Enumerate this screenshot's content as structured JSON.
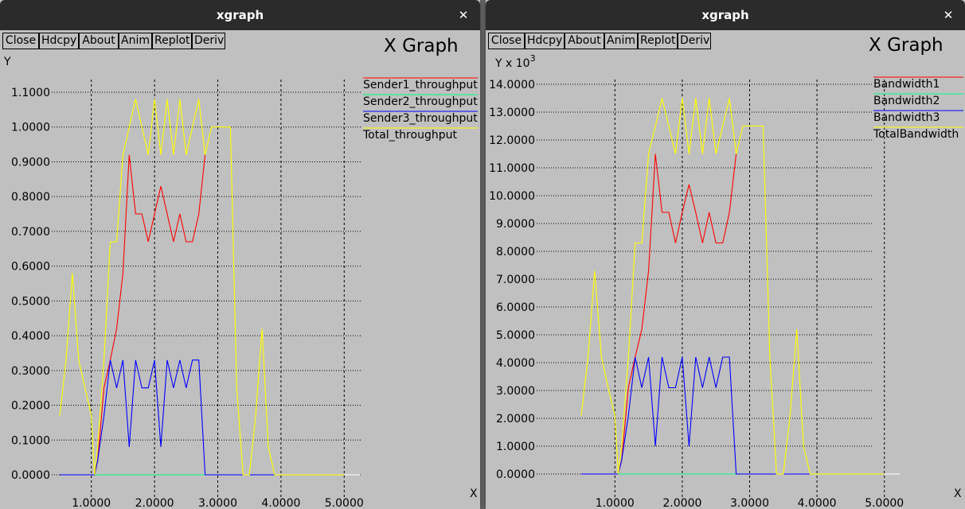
{
  "windows": [
    {
      "id": "left",
      "window_title": "xgraph",
      "buttons": [
        "Close",
        "Hdcpy",
        "About",
        "Anim",
        "Replot",
        "Deriv"
      ],
      "graph_title": "X Graph",
      "ylabel": "Y",
      "xlabel": "X",
      "yticks": [
        "1.1000",
        "1.0000",
        "0.9000",
        "0.8000",
        "0.7000",
        "0.6000",
        "0.5000",
        "0.4000",
        "0.3000",
        "0.2000",
        "0.1000",
        "0.0000"
      ],
      "xticks": [
        "1.0000",
        "2.0000",
        "3.0000",
        "4.0000",
        "5.0000"
      ],
      "legend": [
        "Sender1_throughput",
        "Sender2_throughput",
        "Sender3_throughput",
        "Total_throughput"
      ]
    },
    {
      "id": "right",
      "window_title": "xgraph",
      "buttons": [
        "Close",
        "Hdcpy",
        "About",
        "Anim",
        "Replot",
        "Deriv"
      ],
      "graph_title": "X Graph",
      "ylabel": "Y x 10",
      "ylabel_exp": "3",
      "xlabel": "X",
      "yticks": [
        "14.0000",
        "13.0000",
        "12.0000",
        "11.0000",
        "10.0000",
        "9.0000",
        "8.0000",
        "7.0000",
        "6.0000",
        "5.0000",
        "4.0000",
        "3.0000",
        "2.0000",
        "1.0000",
        "0.0000"
      ],
      "xticks": [
        "1.0000",
        "2.0000",
        "3.0000",
        "4.0000",
        "5.0000"
      ],
      "legend": [
        "Bandwidth1",
        "Bandwidth2",
        "Bandwidth3",
        "TotalBandwidth"
      ]
    }
  ],
  "chart_data": [
    {
      "type": "line",
      "title": "X Graph",
      "xlabel": "X",
      "ylabel": "Y",
      "xlim": [
        0.5,
        5.0
      ],
      "ylim": [
        0,
        1.1
      ],
      "grid": true,
      "legend_position": "right",
      "series": [
        {
          "name": "Sender1_throughput",
          "color": "#ff0000",
          "x": [
            1.0,
            1.05,
            1.1,
            1.2,
            1.3,
            1.4,
            1.5,
            1.6,
            1.7,
            1.8,
            1.9,
            2.0,
            2.1,
            2.2,
            2.3,
            2.4,
            2.5,
            2.6,
            2.7,
            2.8
          ],
          "y": [
            0,
            0,
            0.04,
            0.25,
            0.33,
            0.42,
            0.58,
            0.92,
            0.75,
            0.75,
            0.67,
            0.75,
            0.83,
            0.75,
            0.67,
            0.75,
            0.67,
            0.67,
            0.75,
            0.92
          ]
        },
        {
          "name": "Sender2_throughput",
          "color": "#00ff7f",
          "x": [
            0.5,
            5.0
          ],
          "y": [
            0,
            0
          ]
        },
        {
          "name": "Sender3_throughput",
          "color": "#0000ff",
          "x": [
            0.5,
            1.05,
            1.1,
            1.2,
            1.3,
            1.4,
            1.5,
            1.6,
            1.7,
            1.8,
            1.9,
            2.0,
            2.1,
            2.2,
            2.3,
            2.4,
            2.5,
            2.6,
            2.7,
            2.8,
            3.0,
            4.0,
            5.0
          ],
          "y": [
            0,
            0,
            0.04,
            0.17,
            0.33,
            0.25,
            0.33,
            0.08,
            0.33,
            0.25,
            0.25,
            0.33,
            0.08,
            0.33,
            0.25,
            0.33,
            0.25,
            0.33,
            0.33,
            0,
            0,
            0,
            0
          ]
        },
        {
          "name": "Total_throughput",
          "color": "#ffff00",
          "x": [
            0.5,
            0.6,
            0.7,
            0.8,
            0.9,
            1.0,
            1.05,
            1.1,
            1.2,
            1.3,
            1.4,
            1.5,
            1.6,
            1.7,
            1.8,
            1.9,
            2.0,
            2.1,
            2.2,
            2.3,
            2.4,
            2.5,
            2.6,
            2.7,
            2.8,
            2.9,
            3.0,
            3.1,
            3.2,
            3.3,
            3.4,
            3.5,
            3.6,
            3.7,
            3.8,
            3.9,
            4.0,
            5.0
          ],
          "y": [
            0.17,
            0.33,
            0.58,
            0.33,
            0.25,
            0.17,
            0,
            0.08,
            0.33,
            0.67,
            0.67,
            0.92,
            1.0,
            1.08,
            1.0,
            0.92,
            1.08,
            0.92,
            1.08,
            0.92,
            1.08,
            0.92,
            1.0,
            1.08,
            0.92,
            1.0,
            1.0,
            1.0,
            1.0,
            0.25,
            0,
            0,
            0.17,
            0.42,
            0.08,
            0,
            0,
            0
          ]
        }
      ]
    },
    {
      "type": "line",
      "title": "X Graph",
      "xlabel": "X",
      "ylabel": "Y x 10^3",
      "xlim": [
        0.5,
        5.0
      ],
      "ylim": [
        0,
        14
      ],
      "grid": true,
      "legend_position": "right",
      "series": [
        {
          "name": "Bandwidth1",
          "color": "#ff0000",
          "x": [
            1.0,
            1.05,
            1.1,
            1.2,
            1.3,
            1.4,
            1.5,
            1.6,
            1.7,
            1.8,
            1.9,
            2.0,
            2.1,
            2.2,
            2.3,
            2.4,
            2.5,
            2.6,
            2.7,
            2.8
          ],
          "y": [
            0,
            0,
            0.5,
            3.1,
            4.2,
            5.2,
            7.3,
            11.5,
            9.4,
            9.4,
            8.3,
            9.4,
            10.4,
            9.4,
            8.3,
            9.4,
            8.3,
            8.3,
            9.4,
            11.5
          ]
        },
        {
          "name": "Bandwidth2",
          "color": "#00ff7f",
          "x": [
            0.5,
            5.0
          ],
          "y": [
            0,
            0
          ]
        },
        {
          "name": "Bandwidth3",
          "color": "#0000ff",
          "x": [
            0.5,
            1.05,
            1.1,
            1.2,
            1.3,
            1.4,
            1.5,
            1.6,
            1.7,
            1.8,
            1.9,
            2.0,
            2.1,
            2.2,
            2.3,
            2.4,
            2.5,
            2.6,
            2.7,
            2.8,
            3.0,
            4.0,
            5.0
          ],
          "y": [
            0,
            0,
            0.5,
            2.1,
            4.2,
            3.1,
            4.2,
            1.0,
            4.2,
            3.1,
            3.1,
            4.2,
            1.0,
            4.2,
            3.1,
            4.2,
            3.1,
            4.2,
            4.2,
            0,
            0,
            0,
            0
          ]
        },
        {
          "name": "TotalBandwidth",
          "color": "#ffff00",
          "x": [
            0.5,
            0.6,
            0.7,
            0.8,
            0.9,
            1.0,
            1.05,
            1.1,
            1.2,
            1.3,
            1.4,
            1.5,
            1.6,
            1.7,
            1.8,
            1.9,
            2.0,
            2.1,
            2.2,
            2.3,
            2.4,
            2.5,
            2.6,
            2.7,
            2.8,
            2.9,
            3.0,
            3.1,
            3.2,
            3.3,
            3.4,
            3.5,
            3.6,
            3.7,
            3.8,
            3.9,
            4.0,
            5.0
          ],
          "y": [
            2.1,
            4.2,
            7.3,
            4.2,
            3.1,
            2.1,
            0,
            1.0,
            4.2,
            8.3,
            8.3,
            11.5,
            12.5,
            13.5,
            12.5,
            11.5,
            13.5,
            11.5,
            13.5,
            11.5,
            13.5,
            11.5,
            12.5,
            13.5,
            11.5,
            12.5,
            12.5,
            12.5,
            12.5,
            4.2,
            0,
            0,
            2.1,
            5.2,
            1.0,
            0,
            0,
            0
          ]
        }
      ]
    }
  ]
}
